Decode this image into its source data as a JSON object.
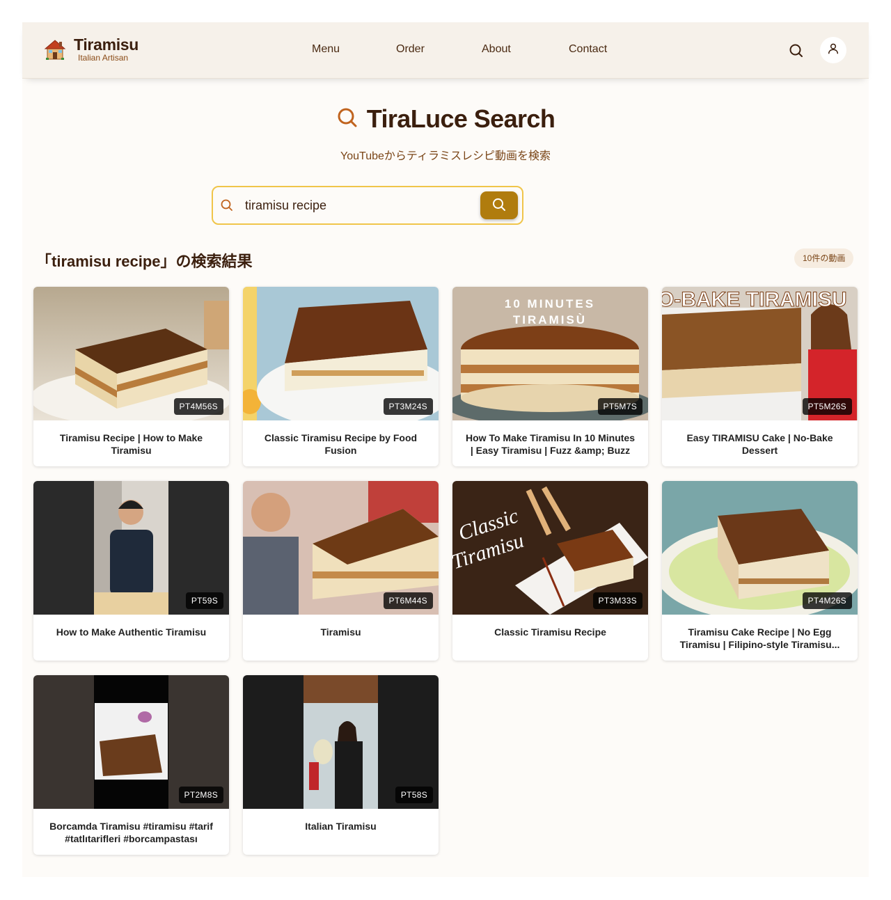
{
  "header": {
    "brand": "Tiramisu",
    "brand_sub": "Italian Artisan",
    "logo_icon": "house-emoji-icon",
    "nav": [
      "Menu",
      "Order",
      "About",
      "Contact"
    ],
    "search_icon": "search-icon",
    "user_icon": "user-icon"
  },
  "hero": {
    "title": "TiraLuce Search",
    "subtitle": "YouTubeからティラミスレシピ動画を検索"
  },
  "search": {
    "value": "tiramisu recipe",
    "placeholder": ""
  },
  "results": {
    "title": "「tiramisu recipe」の検索結果",
    "count_badge": "10件の動画"
  },
  "videos": [
    {
      "title": "Tiramisu Recipe | How to Make Tiramisu",
      "duration": "PT4M56S"
    },
    {
      "title": "Classic Tiramisu Recipe by Food Fusion",
      "duration": "PT3M24S"
    },
    {
      "title": "How To Make Tiramisu In 10 Minutes | Easy Tiramisu | Fuzz &amp; Buzz",
      "duration": "PT5M7S"
    },
    {
      "title": "Easy TIRAMISU Cake | No-Bake Dessert",
      "duration": "PT5M26S"
    },
    {
      "title": "How to Make Authentic Tiramisu",
      "duration": "PT59S"
    },
    {
      "title": "Tiramisu",
      "duration": "PT6M44S"
    },
    {
      "title": "Classic Tiramisu Recipe",
      "duration": "PT3M33S"
    },
    {
      "title": "Tiramisu Cake Recipe | No Egg Tiramisu | Filipino-style Tiramisu...",
      "duration": "PT4M26S"
    },
    {
      "title": "Borcamda Tiramisu #tiramisu #tarif #tatlıtarifleri #borcampastası",
      "duration": "PT2M8S"
    },
    {
      "title": "Italian Tiramisu",
      "duration": "PT58S"
    }
  ],
  "thumbnail_text": {
    "v3": [
      "10 MINUTES",
      "TIRAMISÙ"
    ],
    "v4": "O-BAKE TIRAMISU",
    "v7": [
      "Classic",
      "Tiramisu"
    ]
  },
  "colors": {
    "accent": "#b07c0e",
    "search_border": "#f0c54a",
    "brand_text": "#3b1f0e",
    "sub_text": "#7a4517"
  }
}
